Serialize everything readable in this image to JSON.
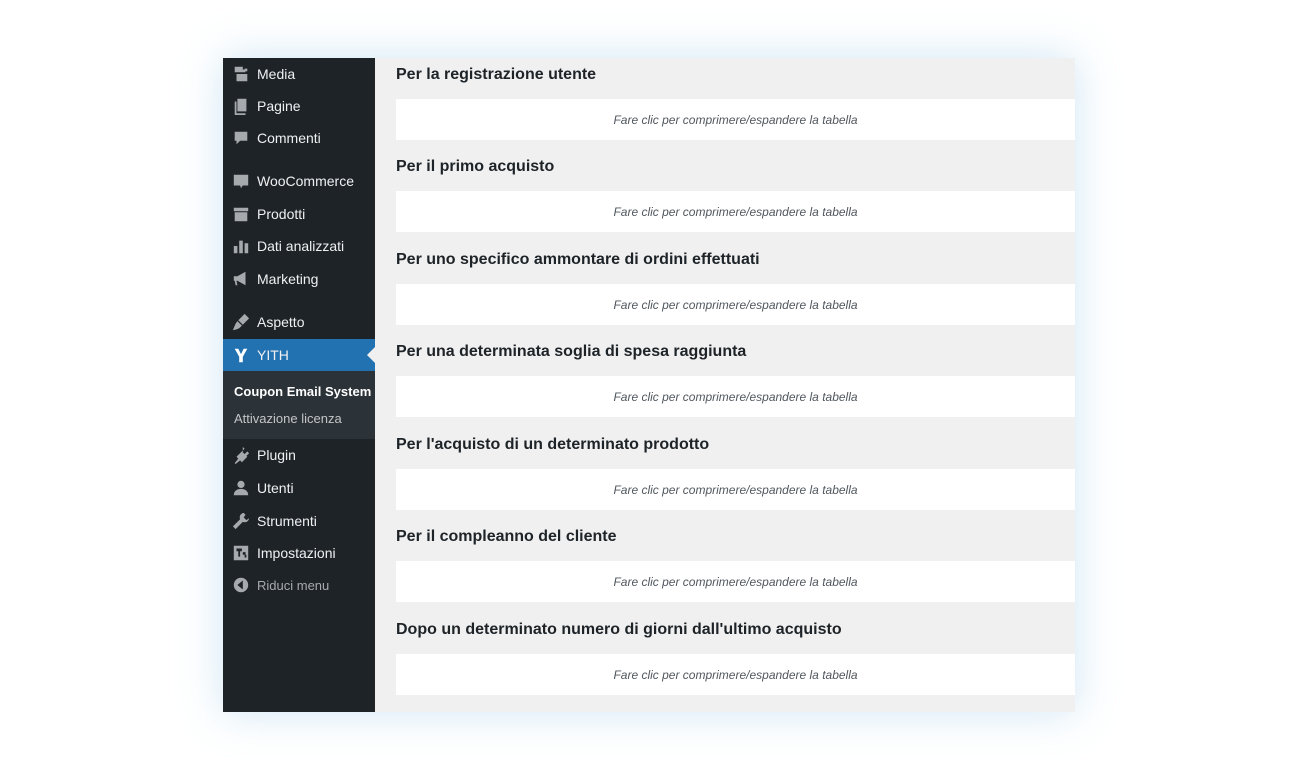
{
  "sidebar": {
    "items": [
      {
        "label": "Media",
        "icon": "media-icon"
      },
      {
        "label": "Pagine",
        "icon": "pages-icon"
      },
      {
        "label": "Commenti",
        "icon": "comments-icon"
      },
      {
        "label": "WooCommerce",
        "icon": "woocommerce-icon"
      },
      {
        "label": "Prodotti",
        "icon": "products-icon"
      },
      {
        "label": "Dati analizzati",
        "icon": "analytics-icon"
      },
      {
        "label": "Marketing",
        "icon": "megaphone-icon"
      },
      {
        "label": "Aspetto",
        "icon": "brush-icon"
      },
      {
        "label": "YITH",
        "icon": "yith-icon"
      },
      {
        "label": "Plugin",
        "icon": "plugin-icon"
      },
      {
        "label": "Utenti",
        "icon": "user-icon"
      },
      {
        "label": "Strumenti",
        "icon": "wrench-icon"
      },
      {
        "label": "Impostazioni",
        "icon": "settings-icon"
      },
      {
        "label": "Riduci menu",
        "icon": "collapse-icon"
      }
    ],
    "submenu": [
      {
        "label": "Coupon Email System"
      },
      {
        "label": "Attivazione licenza"
      }
    ],
    "active_color": "#2271b1"
  },
  "main": {
    "sections": [
      {
        "title": "Per la registrazione utente",
        "toggle": "Fare clic per comprimere/espandere la tabella"
      },
      {
        "title": "Per il primo acquisto",
        "toggle": "Fare clic per comprimere/espandere la tabella"
      },
      {
        "title": "Per uno specifico ammontare di ordini effettuati",
        "toggle": "Fare clic per comprimere/espandere la tabella"
      },
      {
        "title": "Per una determinata soglia di spesa raggiunta",
        "toggle": "Fare clic per comprimere/espandere la tabella"
      },
      {
        "title": "Per l'acquisto di un determinato prodotto",
        "toggle": "Fare clic per comprimere/espandere la tabella"
      },
      {
        "title": "Per il compleanno del cliente",
        "toggle": "Fare clic per comprimere/espandere la tabella"
      },
      {
        "title": "Dopo un determinato numero di giorni dall'ultimo acquisto",
        "toggle": "Fare clic per comprimere/espandere la tabella"
      }
    ]
  }
}
